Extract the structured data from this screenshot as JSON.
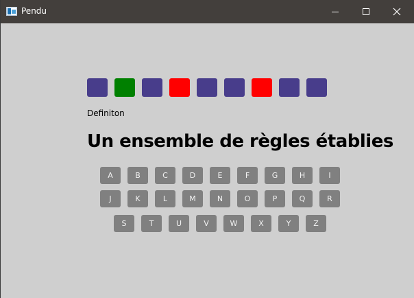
{
  "window": {
    "title": "Pendu"
  },
  "letter_tiles": [
    {
      "color": "#483d8b"
    },
    {
      "color": "#008000"
    },
    {
      "color": "#483d8b"
    },
    {
      "color": "#ff0000"
    },
    {
      "color": "#483d8b"
    },
    {
      "color": "#483d8b"
    },
    {
      "color": "#ff0000"
    },
    {
      "color": "#483d8b"
    },
    {
      "color": "#483d8b"
    }
  ],
  "definition_label": "Definiton",
  "definition_text": "Un ensemble de règles établies",
  "keyboard": {
    "row1": [
      "A",
      "B",
      "C",
      "D",
      "E",
      "F",
      "G",
      "H",
      "I"
    ],
    "row2": [
      "J",
      "K",
      "L",
      "M",
      "N",
      "O",
      "P",
      "Q",
      "R"
    ],
    "row3": [
      "S",
      "T",
      "U",
      "V",
      "W",
      "X",
      "Y",
      "Z"
    ]
  },
  "colors": {
    "background": "#cfcfcf",
    "titlebar": "#433f3c",
    "key": "#808080"
  }
}
